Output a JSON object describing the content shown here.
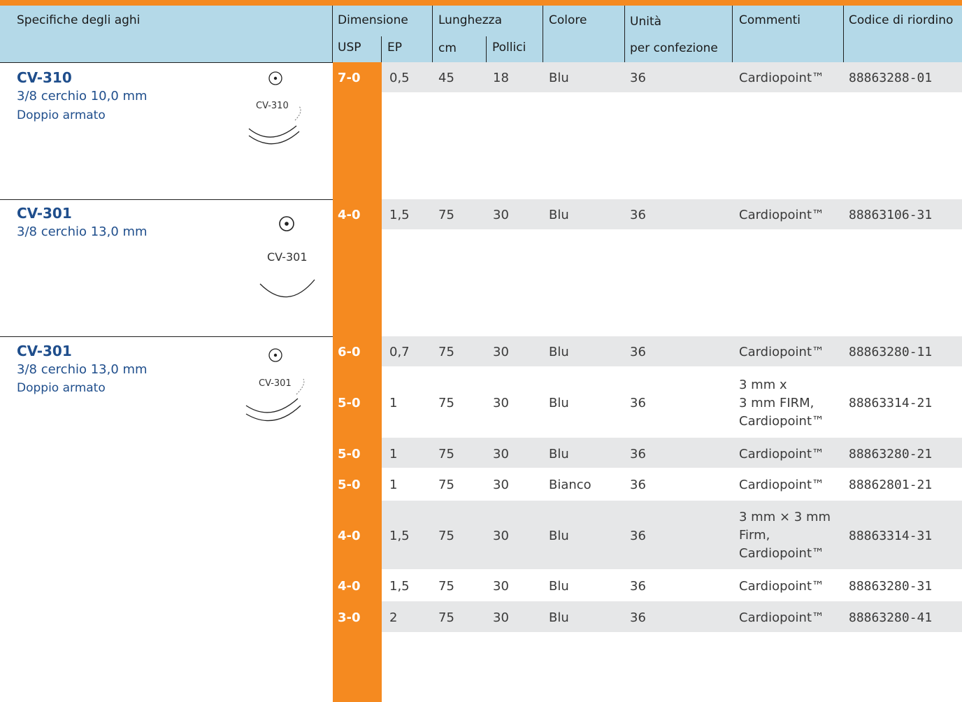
{
  "header": {
    "specs": "Specifiche degli aghi",
    "dimension": "Dimensione",
    "usp": "USP",
    "ep": "EP",
    "length": "Lunghezza",
    "cm": "cm",
    "inches": "Pollici",
    "color": "Colore",
    "units": "Unità",
    "per_pack": "per confezione",
    "comments": "Commenti",
    "reorder": "Codice di riordino"
  },
  "needles": [
    {
      "name": "CV-310",
      "spec": "3/8 cerchio   10,0 mm",
      "sub": "Doppio armato",
      "glyph_label": "CV-310"
    },
    {
      "name": "CV-301",
      "spec": "3/8 cerchio   13,0 mm",
      "sub": "",
      "glyph_label": "CV-301"
    },
    {
      "name": "CV-301",
      "spec": "3/8 cerchio   13,0 mm",
      "sub": "Doppio armato",
      "glyph_label": "CV-301"
    }
  ],
  "rows": [
    {
      "usp": "7-0",
      "ep": "0,5",
      "cm": "45",
      "in": "18",
      "color": "Blu",
      "units": "36",
      "comment": [
        "Cardiopoint™"
      ],
      "code": "88863288-01"
    },
    {
      "usp": "4-0",
      "ep": "1,5",
      "cm": "75",
      "in": "30",
      "color": "Blu",
      "units": "36",
      "comment": [
        "Cardiopoint™"
      ],
      "code": "88863106-31"
    },
    {
      "usp": "6-0",
      "ep": "0,7",
      "cm": "75",
      "in": "30",
      "color": "Blu",
      "units": "36",
      "comment": [
        "Cardiopoint™"
      ],
      "code": "88863280-11"
    },
    {
      "usp": "5-0",
      "ep": "1",
      "cm": "75",
      "in": "30",
      "color": "Blu",
      "units": "36",
      "comment": [
        "3 mm x",
        "3 mm FIRM,",
        "Cardiopoint™"
      ],
      "code": "88863314-21"
    },
    {
      "usp": "5-0",
      "ep": "1",
      "cm": "75",
      "in": "30",
      "color": "Blu",
      "units": "36",
      "comment": [
        "Cardiopoint™"
      ],
      "code": "88863280-21"
    },
    {
      "usp": "5-0",
      "ep": "1",
      "cm": "75",
      "in": "30",
      "color": "Bianco",
      "units": "36",
      "comment": [
        "Cardiopoint™"
      ],
      "code": "88862801-21"
    },
    {
      "usp": "4-0",
      "ep": "1,5",
      "cm": "75",
      "in": "30",
      "color": "Blu",
      "units": "36",
      "comment": [
        "3 mm × 3 mm",
        "Firm,",
        "Cardiopoint™"
      ],
      "code": "88863314-31"
    },
    {
      "usp": "4-0",
      "ep": "1,5",
      "cm": "75",
      "in": "30",
      "color": "Blu",
      "units": "36",
      "comment": [
        "Cardiopoint™"
      ],
      "code": "88863280-31"
    },
    {
      "usp": "3-0",
      "ep": "2",
      "cm": "75",
      "in": "30",
      "color": "Blu",
      "units": "36",
      "comment": [
        "Cardiopoint™"
      ],
      "code": "88863280-41"
    }
  ],
  "colors": {
    "orange": "#f58a20",
    "header_blue": "#b4d9e8",
    "row_shade": "#e6e7e8",
    "needle_blue": "#1f4e8c"
  }
}
